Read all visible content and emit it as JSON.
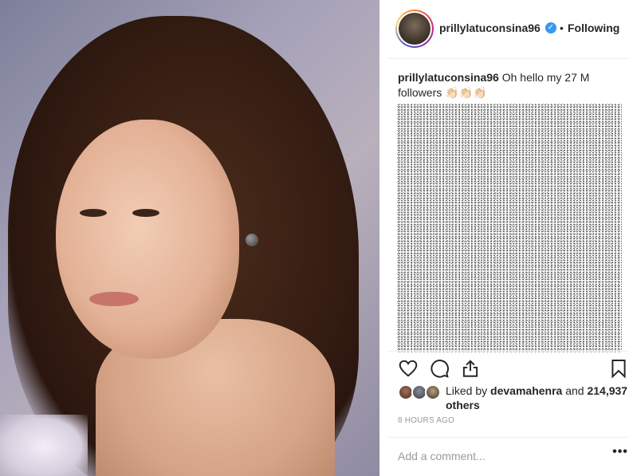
{
  "post": {
    "photo_description_icon": "portrait-photo",
    "author": {
      "username": "prillylatuconsina96",
      "verified": true,
      "verified_icon": "verified-badge-icon",
      "separator": "•",
      "follow_status": "Following"
    },
    "caption": {
      "username": "prillylatuconsina96",
      "text": "Oh hello my 27 M followers 👏🏻👏🏻👏🏻"
    },
    "actions": {
      "like_icon": "heart-icon",
      "comment_icon": "comment-bubble-icon",
      "share_icon": "share-icon",
      "save_icon": "bookmark-icon"
    },
    "likes": {
      "prefix": "Liked by",
      "user": "devamahenra",
      "conjunction": "and",
      "others": "214,937 others"
    },
    "timestamp": "8 HOURS AGO",
    "comment": {
      "placeholder": "Add a comment...",
      "more_label": "•••"
    }
  },
  "colors": {
    "text": "#262626",
    "muted": "#999999",
    "verified": "#3897f0",
    "border": "#efefef"
  }
}
